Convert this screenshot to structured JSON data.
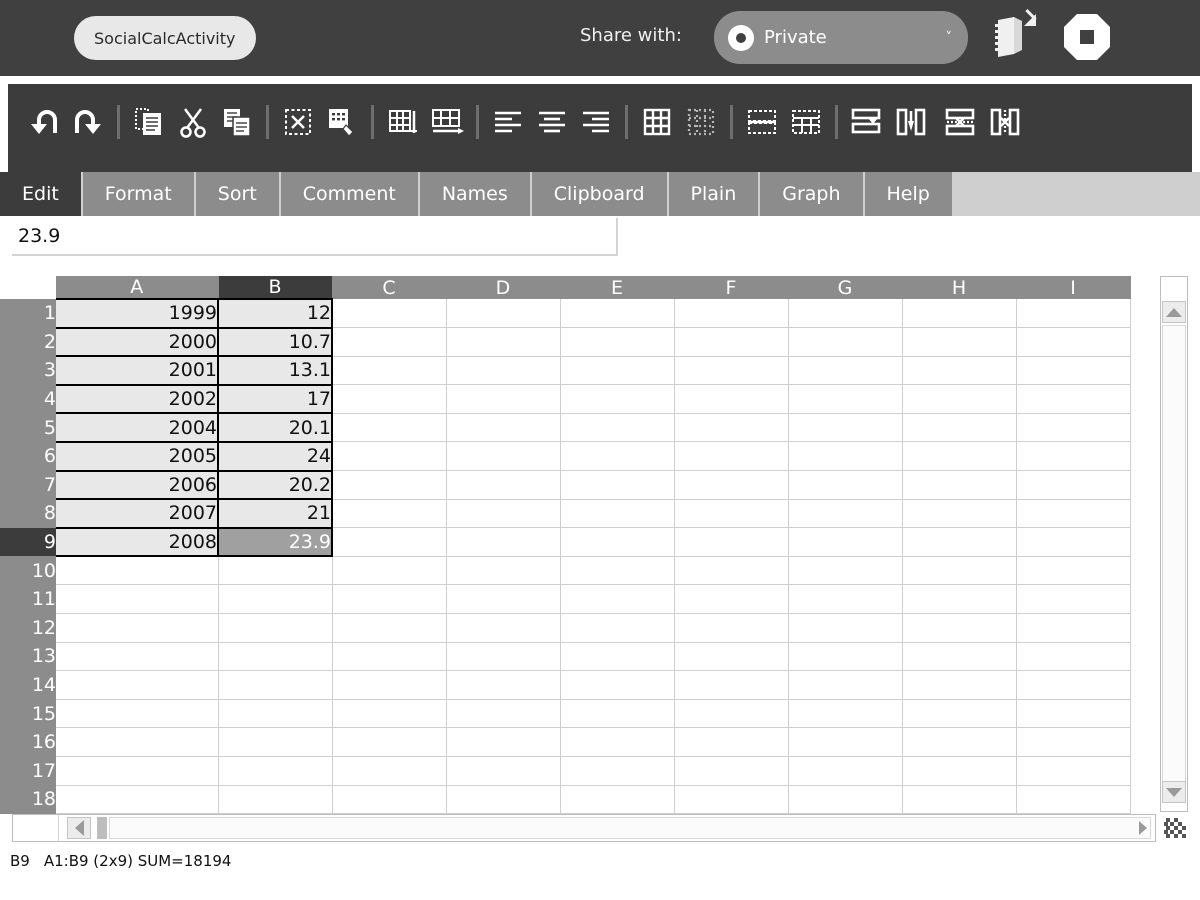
{
  "activity": {
    "title": "SocialCalcActivity",
    "share_label": "Share with:",
    "share_value": "Private",
    "chevron": "˅",
    "keep_icon": "journal-keep-icon",
    "stop_icon": "stop-icon"
  },
  "toolbar": {
    "groups": [
      {
        "items": [
          {
            "name": "undo-icon",
            "title": "Undo"
          },
          {
            "name": "redo-icon",
            "title": "Redo"
          }
        ]
      },
      {
        "items": [
          {
            "name": "paste-icon",
            "title": "Paste"
          },
          {
            "name": "cut-icon",
            "title": "Cut"
          },
          {
            "name": "copy-icon",
            "title": "Copy"
          }
        ]
      },
      {
        "items": [
          {
            "name": "clear-cells-icon",
            "title": "Clear"
          },
          {
            "name": "paste-format-icon",
            "title": "Paste Format"
          }
        ]
      },
      {
        "items": [
          {
            "name": "insert-column-icon",
            "title": "Insert Column"
          },
          {
            "name": "insert-row-icon",
            "title": "Insert Row"
          }
        ]
      },
      {
        "items": [
          {
            "name": "align-left-icon",
            "title": "Align Left"
          },
          {
            "name": "align-center-icon",
            "title": "Align Center"
          },
          {
            "name": "align-right-icon",
            "title": "Align Right"
          }
        ]
      },
      {
        "items": [
          {
            "name": "borders-icon",
            "title": "Borders"
          },
          {
            "name": "no-borders-icon",
            "title": "No Borders"
          }
        ]
      },
      {
        "items": [
          {
            "name": "merge-cells-icon",
            "title": "Merge Cells"
          },
          {
            "name": "split-cells-icon",
            "title": "Split Cells"
          }
        ]
      },
      {
        "items": [
          {
            "name": "add-row-icon",
            "title": "Add Row"
          },
          {
            "name": "add-column-icon",
            "title": "Add Column"
          }
        ]
      },
      {
        "items": [
          {
            "name": "delete-row-icon",
            "title": "Delete Row"
          },
          {
            "name": "delete-column-icon",
            "title": "Delete Column"
          }
        ]
      }
    ]
  },
  "tabs": [
    {
      "label": "Edit",
      "active": true
    },
    {
      "label": "Format",
      "active": false
    },
    {
      "label": "Sort",
      "active": false
    },
    {
      "label": "Comment",
      "active": false
    },
    {
      "label": "Names",
      "active": false
    },
    {
      "label": "Clipboard",
      "active": false
    },
    {
      "label": "Plain",
      "active": false
    },
    {
      "label": "Graph",
      "active": false
    },
    {
      "label": "Help",
      "active": false
    }
  ],
  "formula_bar": {
    "value": "23.9",
    "placeholder": ""
  },
  "grid": {
    "columns": [
      "A",
      "B",
      "C",
      "D",
      "E",
      "F",
      "G",
      "H",
      "I"
    ],
    "selected_column": "B",
    "selected_row": 9,
    "selected_cell": "B9",
    "rows": [
      {
        "num": 1,
        "cells": [
          "1999",
          "12",
          "",
          "",
          "",
          "",
          "",
          "",
          ""
        ]
      },
      {
        "num": 2,
        "cells": [
          "2000",
          "10.7",
          "",
          "",
          "",
          "",
          "",
          "",
          ""
        ]
      },
      {
        "num": 3,
        "cells": [
          "2001",
          "13.1",
          "",
          "",
          "",
          "",
          "",
          "",
          ""
        ]
      },
      {
        "num": 4,
        "cells": [
          "2002",
          "17",
          "",
          "",
          "",
          "",
          "",
          "",
          ""
        ]
      },
      {
        "num": 5,
        "cells": [
          "2004",
          "20.1",
          "",
          "",
          "",
          "",
          "",
          "",
          ""
        ]
      },
      {
        "num": 6,
        "cells": [
          "2005",
          "24",
          "",
          "",
          "",
          "",
          "",
          "",
          ""
        ]
      },
      {
        "num": 7,
        "cells": [
          "2006",
          "20.2",
          "",
          "",
          "",
          "",
          "",
          "",
          ""
        ]
      },
      {
        "num": 8,
        "cells": [
          "2007",
          "21",
          "",
          "",
          "",
          "",
          "",
          "",
          ""
        ]
      },
      {
        "num": 9,
        "cells": [
          "2008",
          "23.9",
          "",
          "",
          "",
          "",
          "",
          "",
          ""
        ]
      },
      {
        "num": 10,
        "cells": [
          "",
          "",
          "",
          "",
          "",
          "",
          "",
          "",
          ""
        ]
      },
      {
        "num": 11,
        "cells": [
          "",
          "",
          "",
          "",
          "",
          "",
          "",
          "",
          ""
        ]
      },
      {
        "num": 12,
        "cells": [
          "",
          "",
          "",
          "",
          "",
          "",
          "",
          "",
          ""
        ]
      },
      {
        "num": 13,
        "cells": [
          "",
          "",
          "",
          "",
          "",
          "",
          "",
          "",
          ""
        ]
      },
      {
        "num": 14,
        "cells": [
          "",
          "",
          "",
          "",
          "",
          "",
          "",
          "",
          ""
        ]
      },
      {
        "num": 15,
        "cells": [
          "",
          "",
          "",
          "",
          "",
          "",
          "",
          "",
          ""
        ]
      },
      {
        "num": 16,
        "cells": [
          "",
          "",
          "",
          "",
          "",
          "",
          "",
          "",
          ""
        ]
      },
      {
        "num": 17,
        "cells": [
          "",
          "",
          "",
          "",
          "",
          "",
          "",
          "",
          ""
        ]
      },
      {
        "num": 18,
        "cells": [
          "",
          "",
          "",
          "",
          "",
          "",
          "",
          "",
          ""
        ]
      }
    ]
  },
  "status": {
    "cell_ref": "B9",
    "summary": "A1:B9 (2x9) SUM=18194"
  },
  "colors": {
    "top_bar": "#404040",
    "cmd_toolbar": "#3c3c3c",
    "tab_inactive": "#8c8c8c",
    "tab_active": "#3c3c3c",
    "header_grey": "#8c8c8c",
    "filled_cell": "#e8e8e8",
    "selected_cell": "#a0a0a0"
  }
}
